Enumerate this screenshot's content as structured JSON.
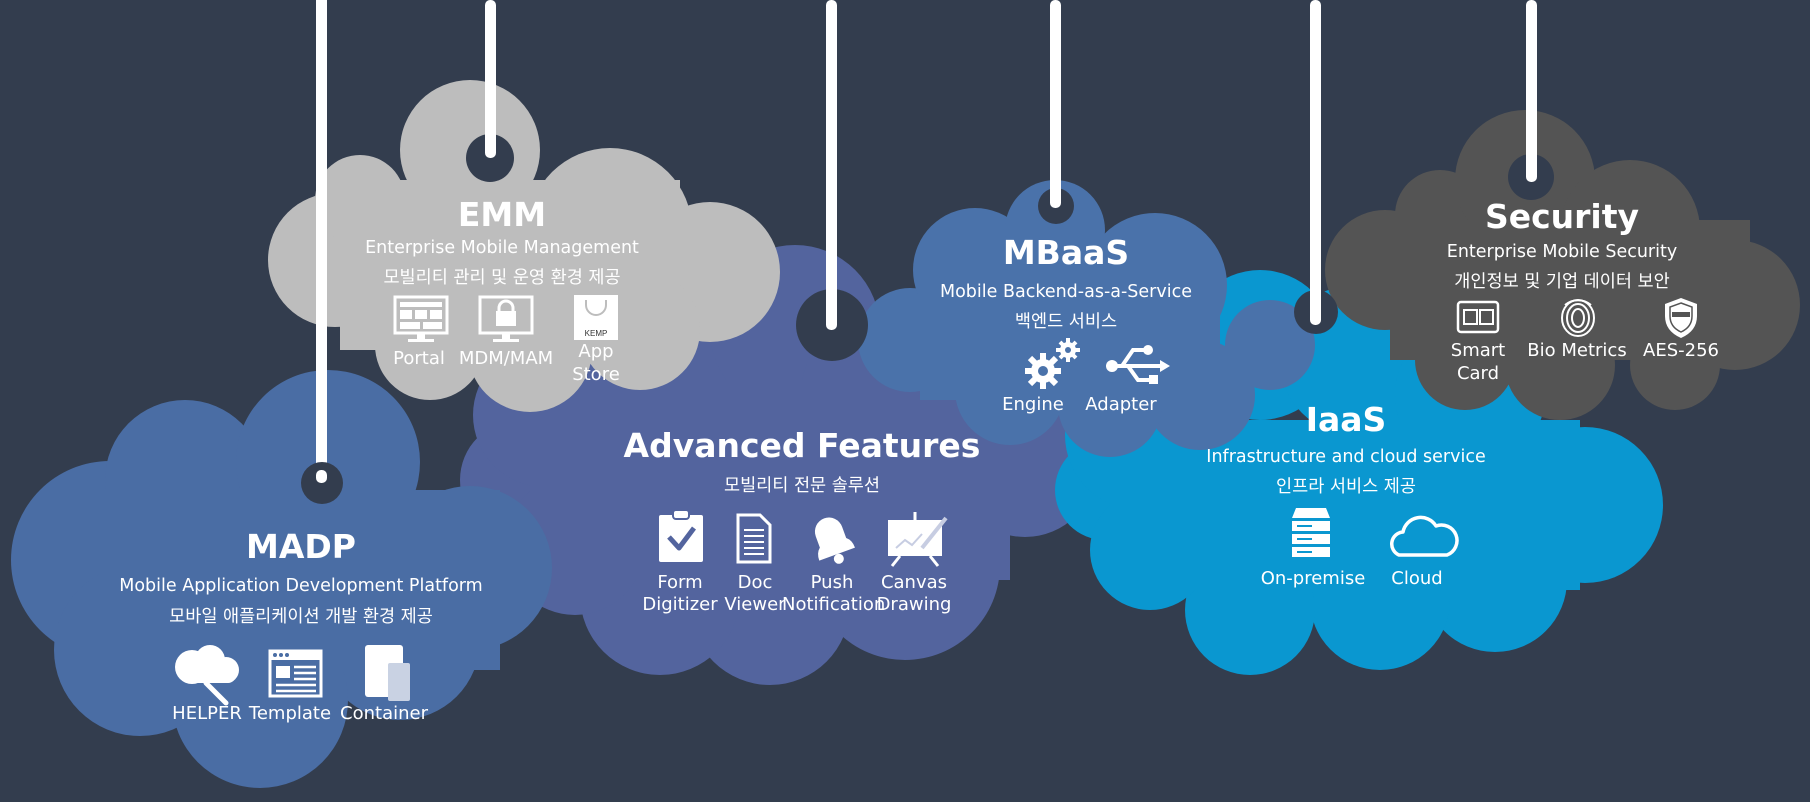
{
  "colors": {
    "background": "#333d4e",
    "madp": "#4a6da4",
    "emm": "#bdbdbd",
    "advanced": "#53649e",
    "mbaas": "#4a72aa",
    "iaas": "#0a97d0",
    "security": "#545454",
    "string": "#ffffff"
  },
  "clouds": {
    "madp": {
      "title": "MADP",
      "subtitle_en": "Mobile Application Development Platform",
      "subtitle_ko": "모바일 애플리케이션 개발 환경 제공",
      "items": [
        {
          "label": "HELPER",
          "icon": "cloud-wrench-icon"
        },
        {
          "label": "Template",
          "icon": "browser-template-icon"
        },
        {
          "label": "Container",
          "icon": "device-container-icon"
        }
      ]
    },
    "emm": {
      "title": "EMM",
      "subtitle_en": "Enterprise Mobile Management",
      "subtitle_ko": "모빌리티 관리 및 운영 환경 제공",
      "items": [
        {
          "label": "Portal",
          "icon": "monitor-portal-icon"
        },
        {
          "label": "MDM/MAM",
          "icon": "monitor-lock-icon"
        },
        {
          "label_1": "App",
          "label_2": "Store",
          "badge": "KEMP",
          "icon": "app-store-bag-icon"
        }
      ]
    },
    "advanced": {
      "title": "Advanced Features",
      "subtitle_ko": "모빌리티 전문 솔루션",
      "items": [
        {
          "label_1": "Form",
          "label_2": "Digitizer",
          "icon": "clipboard-check-icon"
        },
        {
          "label_1": "Doc",
          "label_2": "Viewer",
          "icon": "document-icon"
        },
        {
          "label_1": "Push",
          "label_2": "Notification",
          "icon": "bell-icon"
        },
        {
          "label_1": "Canvas",
          "label_2": "Drawing",
          "icon": "canvas-easel-icon"
        }
      ]
    },
    "mbaas": {
      "title": "MBaaS",
      "subtitle_en": "Mobile Backend-as-a-Service",
      "subtitle_ko": "백엔드 서비스",
      "items": [
        {
          "label": "Engine",
          "icon": "gears-icon"
        },
        {
          "label": "Adapter",
          "icon": "usb-icon"
        }
      ]
    },
    "iaas": {
      "title": "IaaS",
      "subtitle_en": "Infrastructure and cloud service",
      "subtitle_ko": "인프라 서비스 제공",
      "items": [
        {
          "label": "On-premise",
          "icon": "server-stack-icon"
        },
        {
          "label": "Cloud",
          "icon": "cloud-outline-icon"
        }
      ]
    },
    "security": {
      "title": "Security",
      "subtitle_en": "Enterprise Mobile Security",
      "subtitle_ko": "개인정보 및 기업 데이터 보안",
      "items": [
        {
          "label_1": "Smart",
          "label_2": "Card",
          "icon": "smart-card-icon"
        },
        {
          "label": "Bio Metrics",
          "icon": "fingerprint-icon"
        },
        {
          "label": "AES-256",
          "icon": "aes-seal-icon"
        }
      ]
    }
  }
}
